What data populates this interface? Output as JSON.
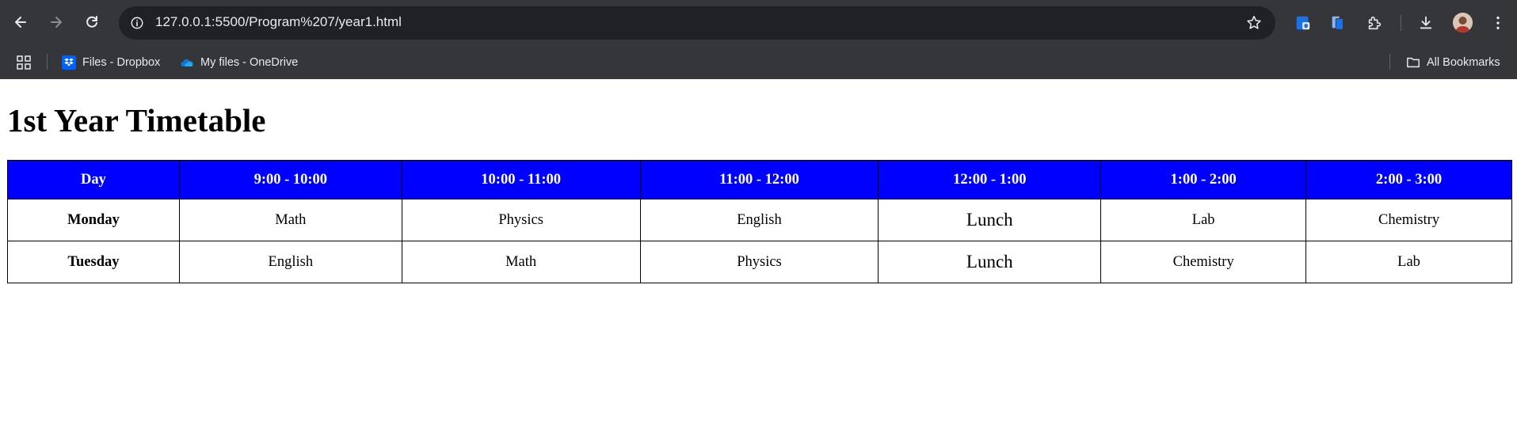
{
  "browser": {
    "url": "127.0.0.1:5500/Program%207/year1.html",
    "bookmarks": [
      {
        "label": "Files - Dropbox",
        "icon": "dropbox-icon"
      },
      {
        "label": "My files - OneDrive",
        "icon": "onedrive-icon"
      }
    ],
    "all_bookmarks_label": "All Bookmarks",
    "colors": {
      "chrome_bg": "#35363a",
      "omnibox_bg": "#202124",
      "text": "#e8eaed"
    }
  },
  "page": {
    "title": "1st Year Timetable",
    "header_color": "#0000ff",
    "table": {
      "headers": [
        "Day",
        "9:00 - 10:00",
        "10:00 - 11:00",
        "11:00 - 12:00",
        "12:00 - 1:00",
        "1:00 - 2:00",
        "2:00 - 3:00"
      ],
      "rows": [
        {
          "day": "Monday",
          "cells": [
            "Math",
            "Physics",
            "English",
            "Lunch",
            "Lab",
            "Chemistry"
          ]
        },
        {
          "day": "Tuesday",
          "cells": [
            "English",
            "Math",
            "Physics",
            "Lunch",
            "Chemistry",
            "Lab"
          ]
        }
      ]
    }
  }
}
